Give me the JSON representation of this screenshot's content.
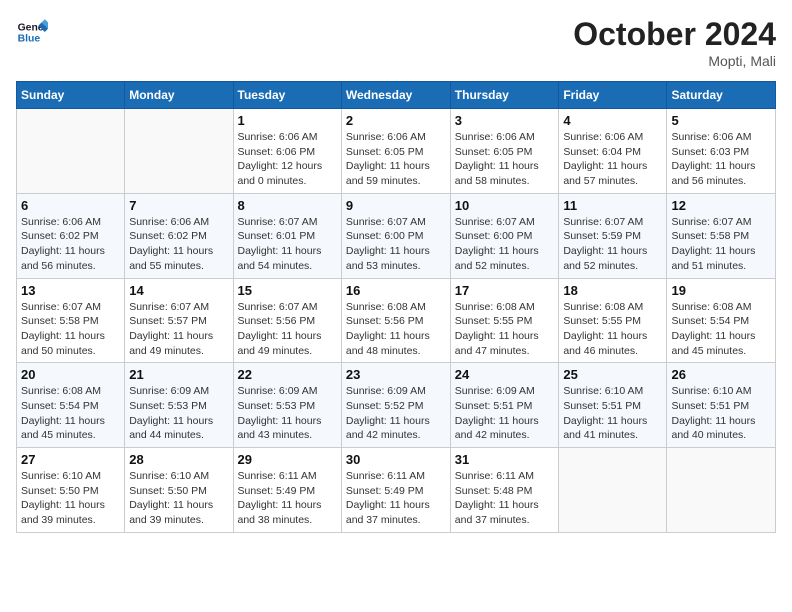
{
  "header": {
    "logo_line1": "General",
    "logo_line2": "Blue",
    "month": "October 2024",
    "location": "Mopti, Mali"
  },
  "weekdays": [
    "Sunday",
    "Monday",
    "Tuesday",
    "Wednesday",
    "Thursday",
    "Friday",
    "Saturday"
  ],
  "weeks": [
    [
      {
        "day": "",
        "info": ""
      },
      {
        "day": "",
        "info": ""
      },
      {
        "day": "1",
        "info": "Sunrise: 6:06 AM\nSunset: 6:06 PM\nDaylight: 12 hours\nand 0 minutes."
      },
      {
        "day": "2",
        "info": "Sunrise: 6:06 AM\nSunset: 6:05 PM\nDaylight: 11 hours\nand 59 minutes."
      },
      {
        "day": "3",
        "info": "Sunrise: 6:06 AM\nSunset: 6:05 PM\nDaylight: 11 hours\nand 58 minutes."
      },
      {
        "day": "4",
        "info": "Sunrise: 6:06 AM\nSunset: 6:04 PM\nDaylight: 11 hours\nand 57 minutes."
      },
      {
        "day": "5",
        "info": "Sunrise: 6:06 AM\nSunset: 6:03 PM\nDaylight: 11 hours\nand 56 minutes."
      }
    ],
    [
      {
        "day": "6",
        "info": "Sunrise: 6:06 AM\nSunset: 6:02 PM\nDaylight: 11 hours\nand 56 minutes."
      },
      {
        "day": "7",
        "info": "Sunrise: 6:06 AM\nSunset: 6:02 PM\nDaylight: 11 hours\nand 55 minutes."
      },
      {
        "day": "8",
        "info": "Sunrise: 6:07 AM\nSunset: 6:01 PM\nDaylight: 11 hours\nand 54 minutes."
      },
      {
        "day": "9",
        "info": "Sunrise: 6:07 AM\nSunset: 6:00 PM\nDaylight: 11 hours\nand 53 minutes."
      },
      {
        "day": "10",
        "info": "Sunrise: 6:07 AM\nSunset: 6:00 PM\nDaylight: 11 hours\nand 52 minutes."
      },
      {
        "day": "11",
        "info": "Sunrise: 6:07 AM\nSunset: 5:59 PM\nDaylight: 11 hours\nand 52 minutes."
      },
      {
        "day": "12",
        "info": "Sunrise: 6:07 AM\nSunset: 5:58 PM\nDaylight: 11 hours\nand 51 minutes."
      }
    ],
    [
      {
        "day": "13",
        "info": "Sunrise: 6:07 AM\nSunset: 5:58 PM\nDaylight: 11 hours\nand 50 minutes."
      },
      {
        "day": "14",
        "info": "Sunrise: 6:07 AM\nSunset: 5:57 PM\nDaylight: 11 hours\nand 49 minutes."
      },
      {
        "day": "15",
        "info": "Sunrise: 6:07 AM\nSunset: 5:56 PM\nDaylight: 11 hours\nand 49 minutes."
      },
      {
        "day": "16",
        "info": "Sunrise: 6:08 AM\nSunset: 5:56 PM\nDaylight: 11 hours\nand 48 minutes."
      },
      {
        "day": "17",
        "info": "Sunrise: 6:08 AM\nSunset: 5:55 PM\nDaylight: 11 hours\nand 47 minutes."
      },
      {
        "day": "18",
        "info": "Sunrise: 6:08 AM\nSunset: 5:55 PM\nDaylight: 11 hours\nand 46 minutes."
      },
      {
        "day": "19",
        "info": "Sunrise: 6:08 AM\nSunset: 5:54 PM\nDaylight: 11 hours\nand 45 minutes."
      }
    ],
    [
      {
        "day": "20",
        "info": "Sunrise: 6:08 AM\nSunset: 5:54 PM\nDaylight: 11 hours\nand 45 minutes."
      },
      {
        "day": "21",
        "info": "Sunrise: 6:09 AM\nSunset: 5:53 PM\nDaylight: 11 hours\nand 44 minutes."
      },
      {
        "day": "22",
        "info": "Sunrise: 6:09 AM\nSunset: 5:53 PM\nDaylight: 11 hours\nand 43 minutes."
      },
      {
        "day": "23",
        "info": "Sunrise: 6:09 AM\nSunset: 5:52 PM\nDaylight: 11 hours\nand 42 minutes."
      },
      {
        "day": "24",
        "info": "Sunrise: 6:09 AM\nSunset: 5:51 PM\nDaylight: 11 hours\nand 42 minutes."
      },
      {
        "day": "25",
        "info": "Sunrise: 6:10 AM\nSunset: 5:51 PM\nDaylight: 11 hours\nand 41 minutes."
      },
      {
        "day": "26",
        "info": "Sunrise: 6:10 AM\nSunset: 5:51 PM\nDaylight: 11 hours\nand 40 minutes."
      }
    ],
    [
      {
        "day": "27",
        "info": "Sunrise: 6:10 AM\nSunset: 5:50 PM\nDaylight: 11 hours\nand 39 minutes."
      },
      {
        "day": "28",
        "info": "Sunrise: 6:10 AM\nSunset: 5:50 PM\nDaylight: 11 hours\nand 39 minutes."
      },
      {
        "day": "29",
        "info": "Sunrise: 6:11 AM\nSunset: 5:49 PM\nDaylight: 11 hours\nand 38 minutes."
      },
      {
        "day": "30",
        "info": "Sunrise: 6:11 AM\nSunset: 5:49 PM\nDaylight: 11 hours\nand 37 minutes."
      },
      {
        "day": "31",
        "info": "Sunrise: 6:11 AM\nSunset: 5:48 PM\nDaylight: 11 hours\nand 37 minutes."
      },
      {
        "day": "",
        "info": ""
      },
      {
        "day": "",
        "info": ""
      }
    ]
  ]
}
